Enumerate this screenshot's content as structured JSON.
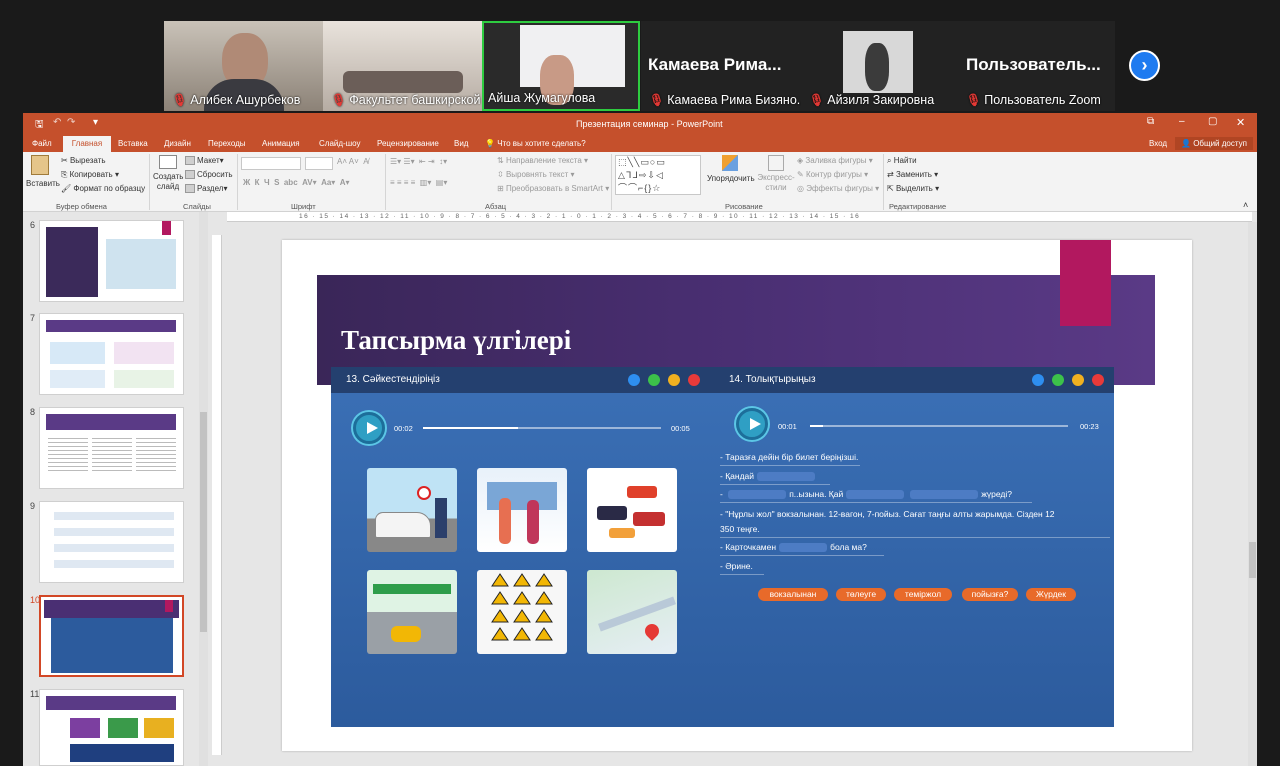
{
  "zoom": {
    "participants": [
      {
        "name": "Алибек Ашурбеков"
      },
      {
        "name": "Факультет башкирской ф..."
      },
      {
        "name": "Айша Жумагулова"
      },
      {
        "name": "Камаева Рима Бизяно...",
        "banner": "Камаева  Рима..."
      },
      {
        "name": "Айзиля Закировна"
      },
      {
        "name": "Пользователь Zoom",
        "banner": "Пользователь..."
      }
    ],
    "next_icon": "chevron-right-icon"
  },
  "ppt": {
    "window_title": "Презентация семинар - PowerPoint",
    "tabs": [
      "Файл",
      "Главная",
      "Вставка",
      "Дизайн",
      "Переходы",
      "Анимация",
      "Слайд-шоу",
      "Рецензирование",
      "Вид"
    ],
    "tell_me": "Что вы хотите сделать?",
    "signin": "Вход",
    "share": "Общий доступ",
    "ribbon": {
      "paste": "Вставить",
      "cut": "Вырезать",
      "copy": "Копировать",
      "format_painter": "Формат по образцу",
      "new_slide": "Создать слайд",
      "layout": "Макет",
      "reset": "Сбросить",
      "section": "Раздел",
      "text_direction": "Направление текста",
      "align_text": "Выровнять текст",
      "smartart": "Преобразовать в SmartArt",
      "arrange": "Упорядочить",
      "quick_styles": "Экспресс-стили",
      "shape_fill": "Заливка фигуры",
      "shape_outline": "Контур фигуры",
      "shape_effects": "Эффекты фигуры",
      "find": "Найти",
      "replace": "Заменить",
      "select": "Выделить",
      "groups": {
        "clipboard": "Буфер обмена",
        "slides": "Слайды",
        "font": "Шрифт",
        "paragraph": "Абзац",
        "drawing": "Рисование",
        "editing": "Редактирование"
      }
    },
    "thumbnails": [
      {
        "num": "6"
      },
      {
        "num": "7"
      },
      {
        "num": "8"
      },
      {
        "num": "9"
      },
      {
        "num": "10"
      },
      {
        "num": "11"
      }
    ],
    "ruler_labels": "16 · 15 · 14 · 13 · 12 · 11 · 10 · 9 · 8 · 7 · 6 · 5 · 4 · 3 · 2 · 1 · 0 · 1 · 2 · 3 · 4 · 5 · 6 · 7 · 8 · 9 · 10 · 11 · 12 · 13 · 14 · 15 · 16"
  },
  "slide": {
    "title": "Тапсырма үлгілері",
    "left_panel": {
      "heading": "13. Сәйкестендіріңіз",
      "time_start": "00:02",
      "time_end": "00:05",
      "progress": 0.4
    },
    "right_panel": {
      "heading": "14. Толықтырыңыз",
      "time_start": "00:01",
      "time_end": "00:23",
      "progress": 0.05,
      "lines": [
        "- Таразға дейін бір билет беріңізші.",
        "- Қандай",
        "жүреді?",
        "- \"Нұрлы жол\" вокзалынан. 12-вагон, 7-пойыз. Сағат таңғы алты жарымда. Сізден 12",
        "350 теңге.",
        "- Карточкамен",
        "бола ма?",
        "- Әрине."
      ],
      "line3_mid": "п..ызына. Қай",
      "chips": [
        "вокзалынан",
        "төлеуге",
        "теміржол",
        "пойызға?",
        "Жүрдек"
      ]
    }
  },
  "colors": {
    "ppt_accent": "#c5502c",
    "banner": "#4a2f73",
    "pink": "#b2185f",
    "panel": "#2c5b9d",
    "chip": "#e86a2a"
  }
}
